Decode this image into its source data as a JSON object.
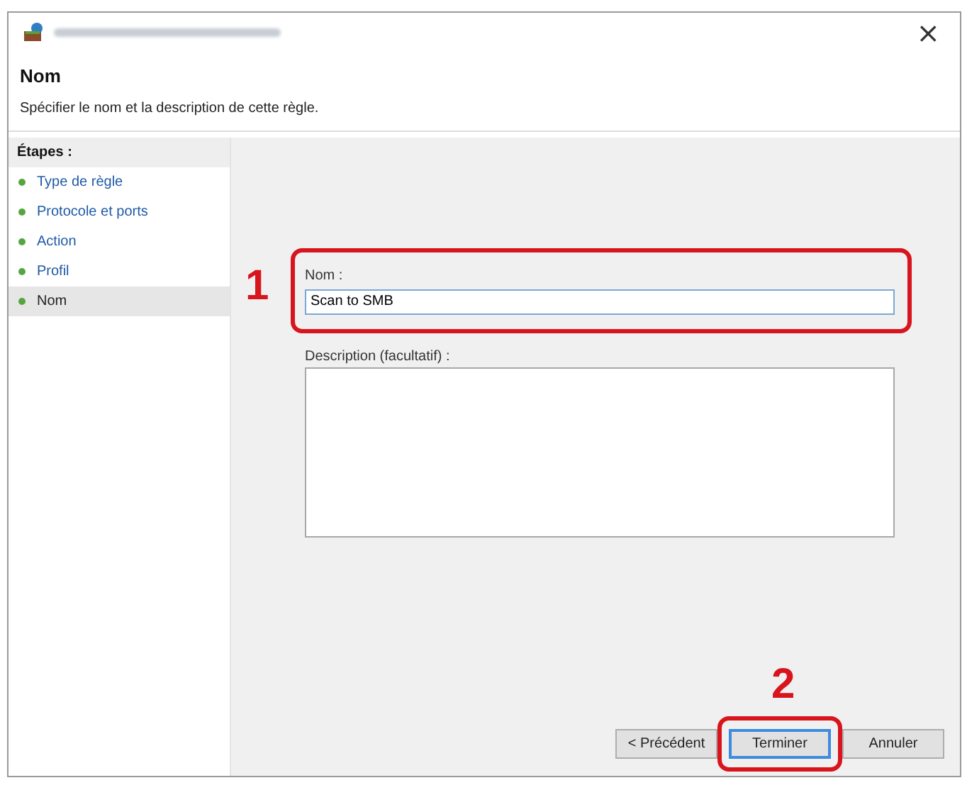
{
  "window": {
    "close_glyph": "×"
  },
  "header": {
    "title": "Nom",
    "subtitle": "Spécifier le nom et la description de cette règle."
  },
  "steps": {
    "heading": "Étapes :",
    "items": [
      {
        "label": "Type de règle",
        "selected": false
      },
      {
        "label": "Protocole et ports",
        "selected": false
      },
      {
        "label": "Action",
        "selected": false
      },
      {
        "label": "Profil",
        "selected": false
      },
      {
        "label": "Nom",
        "selected": true
      }
    ]
  },
  "form": {
    "name_label": "Nom :",
    "name_value": "Scan to SMB",
    "name_callout": "1",
    "description_label": "Description (facultatif) :"
  },
  "buttons": [
    {
      "label": "< Précédent",
      "selected": false
    },
    {
      "label": "Terminer",
      "selected": true,
      "callout": "2"
    },
    {
      "label": "Annuler",
      "selected": false
    }
  ]
}
